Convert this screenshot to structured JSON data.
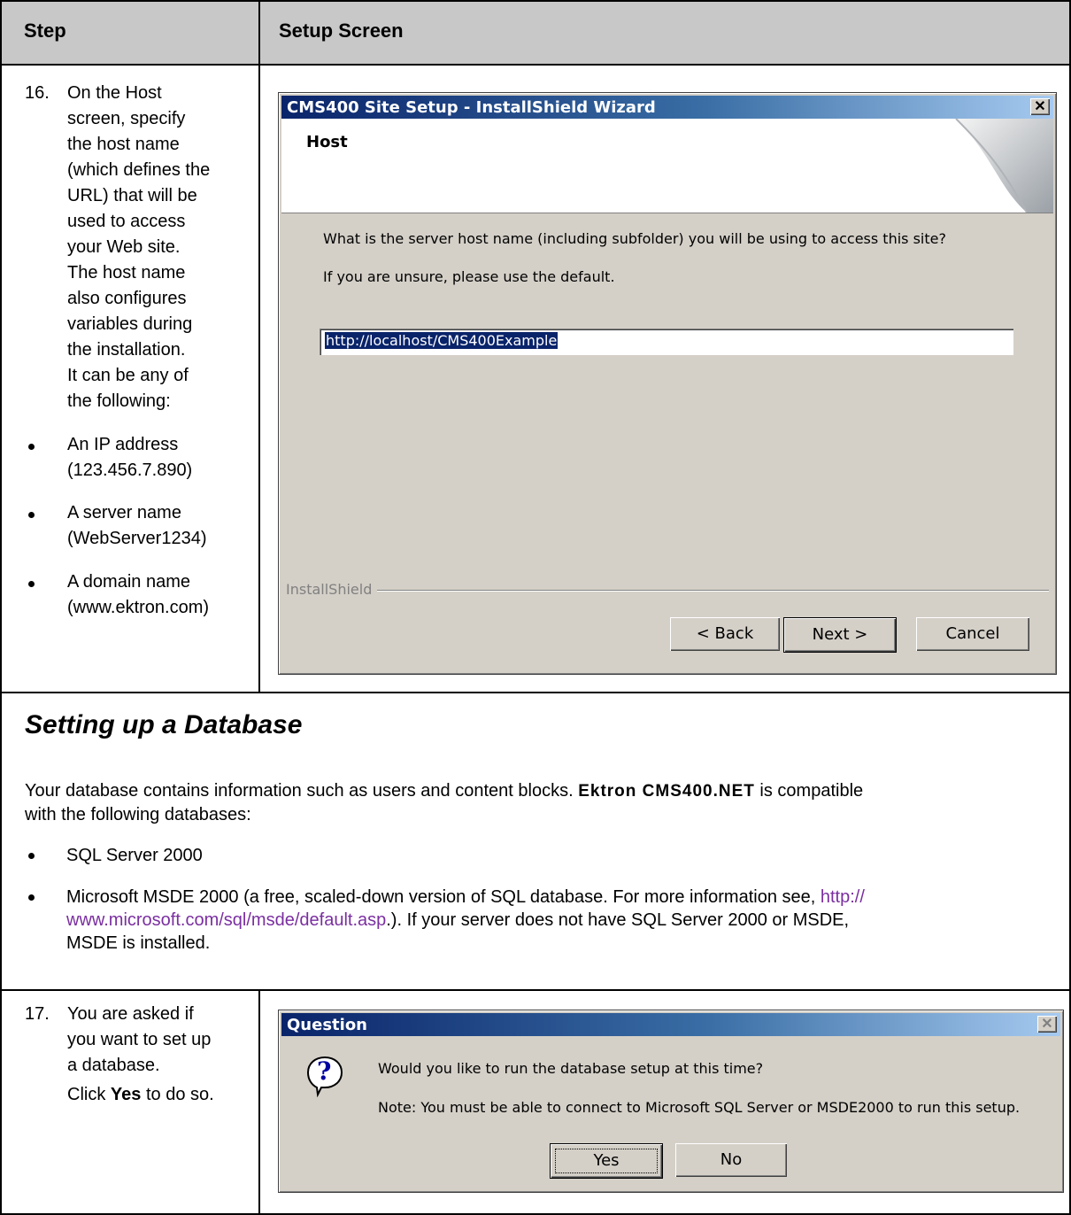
{
  "table": {
    "header_step": "Step",
    "header_setup": "Setup Screen"
  },
  "step16": {
    "number": "16.",
    "text_lines": [
      "On the Host",
      "screen, specify",
      "the host name",
      "(which defines the",
      "URL) that will be",
      "used to access",
      "your Web site.",
      "The host name",
      "also configures",
      "variables during",
      "the installation.",
      "It can be any of",
      "the following:"
    ],
    "bullets": [
      {
        "line1": "An IP address",
        "line2": "(123.456.7.890)"
      },
      {
        "line1": "A server name",
        "line2": "(WebServer1234)"
      },
      {
        "line1": "A domain name",
        "line2": "(www.ektron.com)"
      }
    ]
  },
  "wizard": {
    "title": "CMS400 Site Setup - InstallShield Wizard",
    "close_symbol": "✕",
    "heading": "Host",
    "question": "What is the server host name (including subfolder) you will be using to access this site?",
    "hint": "If you are unsure, please use the default.",
    "host_value": "http://localhost/CMS400Example",
    "installshield_label": "InstallShield",
    "back_label": "< Back",
    "next_label": "Next >",
    "cancel_label": "Cancel"
  },
  "section": {
    "title": "Setting up a Database",
    "intro_pre": "Your database contains information such as users and content blocks.",
    "brand": "Ektron CMS400.NET",
    "intro_post": "is compatible",
    "intro_line2": "with the following databases:",
    "bullet1": "SQL Server 2000",
    "bullet2_line1_pre": "Microsoft MSDE 2000 (a free, scaled-down version of SQL database. For more information see,",
    "bullet2_link1": "http://",
    "bullet2_link2": "www.microsoft.com/sql/msde/default.asp",
    "bullet2_line2_post": ".). If your server does not have SQL Server 2000 or MSDE,",
    "bullet2_line3": "MSDE is installed."
  },
  "step17": {
    "number": "17.",
    "text_lines": [
      "You are asked if",
      "you want to set up",
      "a database."
    ],
    "click_pre": "Click",
    "click_bold": "Yes",
    "click_post": "to do so."
  },
  "question_dialog": {
    "title": "Question",
    "close_symbol": "✕",
    "icon_glyph": "?",
    "line1": "Would you like to run the database setup at this time?",
    "line2": "Note: You must be able to connect to Microsoft SQL Server or MSDE2000 to run this setup.",
    "yes_label": "Yes",
    "no_label": "No"
  }
}
